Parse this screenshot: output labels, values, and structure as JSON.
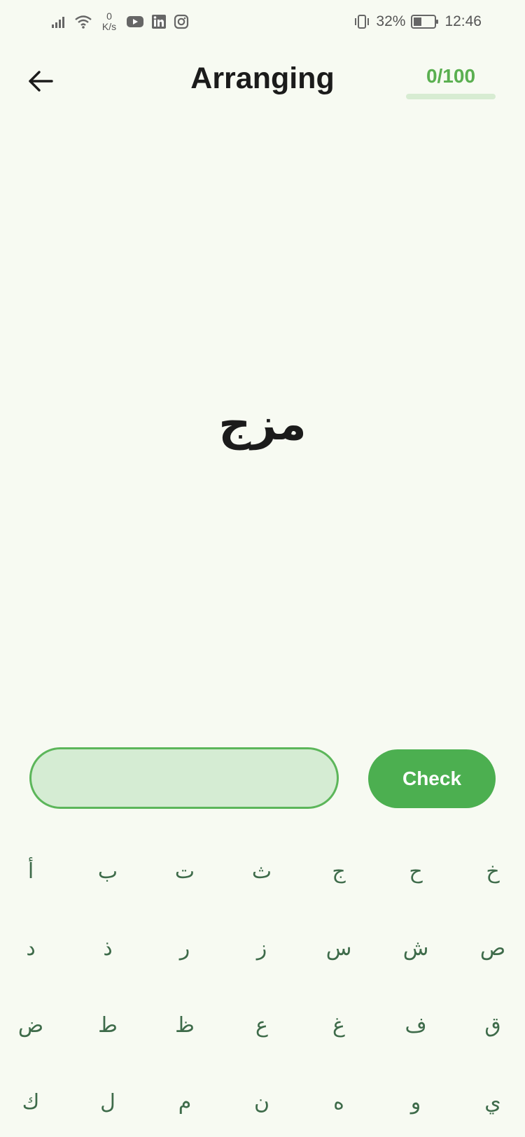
{
  "status_bar": {
    "net_speed_value": "0",
    "net_speed_unit": "K/s",
    "battery_percent": "32%",
    "time": "12:46",
    "icons": [
      "signal-icon",
      "wifi-icon",
      "youtube-icon",
      "linkedin-icon",
      "instagram-icon",
      "vibrate-icon",
      "battery-icon"
    ]
  },
  "header": {
    "title": "Arranging",
    "progress_text": "0/100",
    "progress_fraction": 0
  },
  "word": "مزج",
  "answer": {
    "value": "",
    "placeholder": ""
  },
  "check_label": "Check",
  "keyboard": {
    "rows": [
      [
        "أ",
        "ب",
        "ت",
        "ث",
        "ج",
        "ح",
        "خ"
      ],
      [
        "د",
        "ذ",
        "ر",
        "ز",
        "س",
        "ش",
        "ص"
      ],
      [
        "ض",
        "ط",
        "ظ",
        "ع",
        "غ",
        "ف",
        "ق"
      ],
      [
        "ك",
        "ل",
        "م",
        "ن",
        "ه",
        "و",
        "ي"
      ]
    ]
  },
  "colors": {
    "background": "#f7faf2",
    "accent": "#4caf50",
    "input_fill": "#d5ecd3",
    "key_text": "#3e6b4a"
  }
}
